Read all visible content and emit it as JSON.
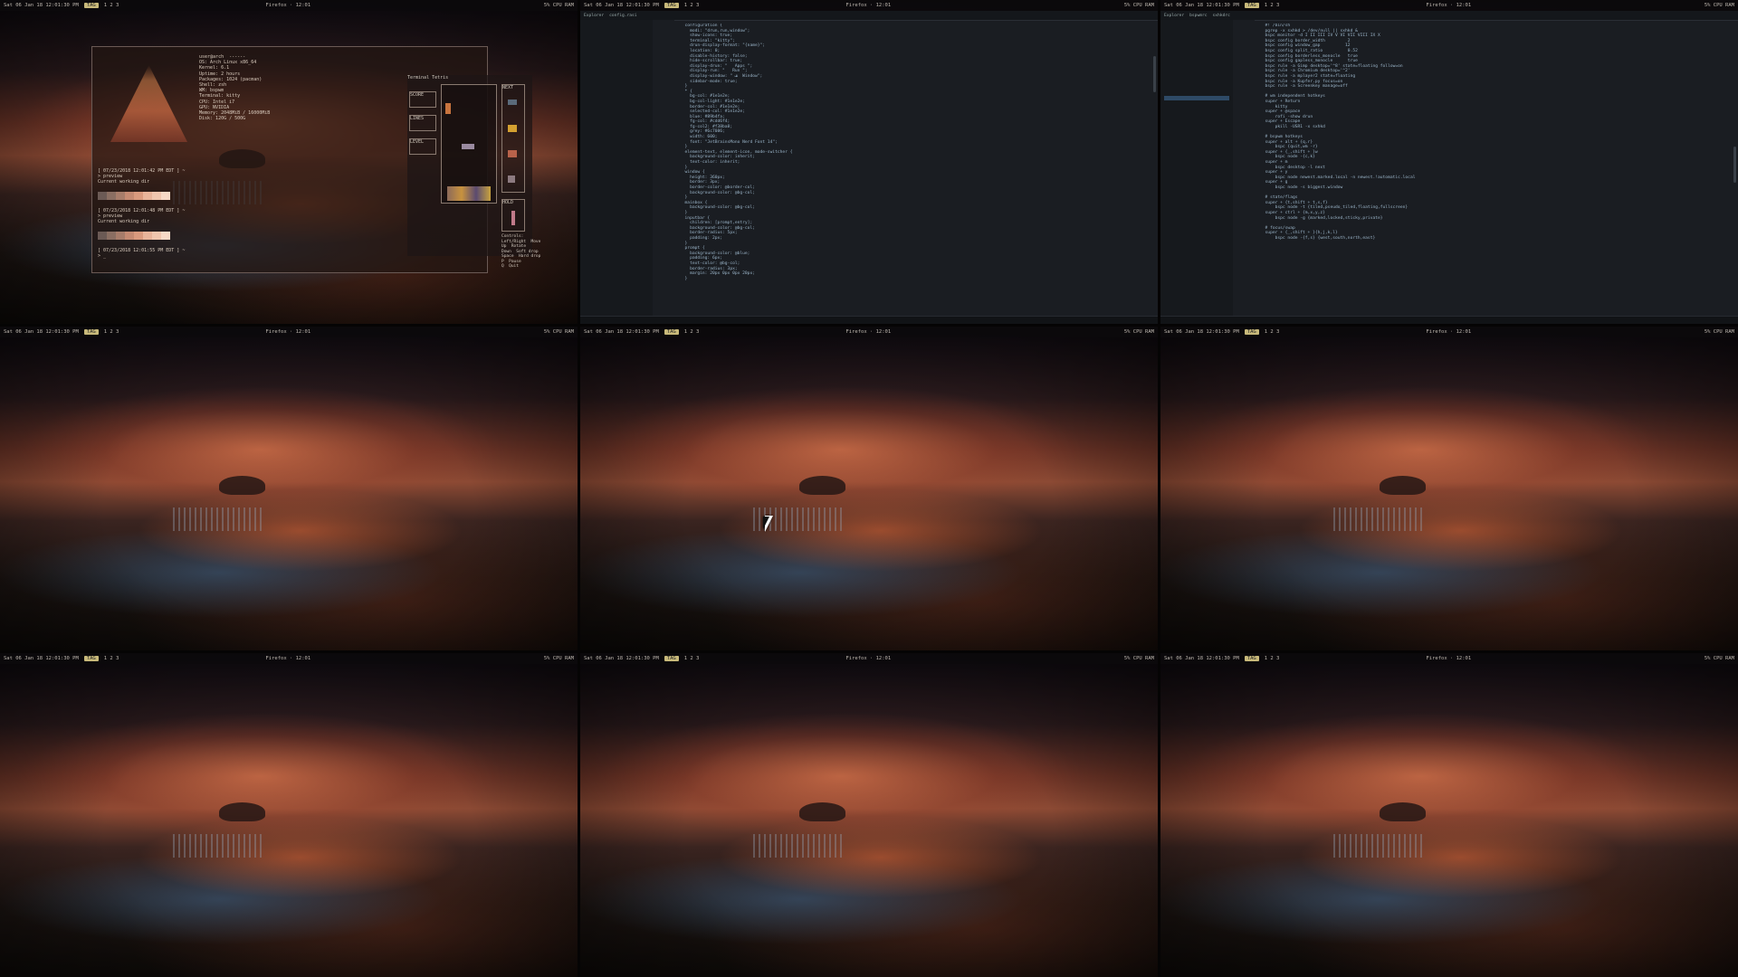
{
  "bar": {
    "left_text": "Sat 06 Jan 18  12:01:30 PM",
    "tag": "TAG",
    "tags_extra": "1 2 3",
    "center_text": "Firefox  ·  12:01",
    "right_text": "5%  CPU  RAM"
  },
  "workspaces": [
    {
      "id": 1,
      "name": "workspace-1",
      "content": "terminal"
    },
    {
      "id": 2,
      "name": "workspace-2",
      "content": "editor"
    },
    {
      "id": 3,
      "name": "workspace-3",
      "content": "editor"
    },
    {
      "id": 4,
      "name": "workspace-4",
      "content": "wallpaper"
    },
    {
      "id": 5,
      "name": "workspace-5",
      "content": "wallpaper"
    },
    {
      "id": 6,
      "name": "workspace-6",
      "content": "wallpaper"
    },
    {
      "id": 7,
      "name": "workspace-7",
      "content": "wallpaper"
    },
    {
      "id": 8,
      "name": "workspace-8",
      "content": "wallpaper"
    },
    {
      "id": 9,
      "name": "workspace-9",
      "content": "wallpaper"
    }
  ],
  "terminal": {
    "info_lines": "user@arch  ------\nOS: Arch Linux x86_64\nKernel: 6.1\nUptime: 2 hours\nPackages: 1024 (pacman)\nShell: zsh\nWM: bspwm\nTerminal: kitty\nCPU: Intel i7\nGPU: NVIDIA\nMemory: 2048MiB / 16000MiB\nDisk: 120G / 500G",
    "prompt1": "[ 07/23/2018 12:01:42 PM EDT ] ~\n> preview\nCurrent working dir",
    "prompt2": "[ 07/23/2018 12:01:48 PM EDT ] ~\n> preview\nCurrent working dir",
    "prompt3": "[ 07/23/2018 12:01:55 PM EDT ] ~\n> _",
    "swatch_colors": [
      "#6b5a55",
      "#8a6e62",
      "#a67c6a",
      "#c48a72",
      "#d99a7e",
      "#e8b49a",
      "#f0c6ae",
      "#f7d9c6"
    ]
  },
  "tetris": {
    "title": "Terminal Tetris",
    "score_label": "SCORE",
    "lines_label": "LINES",
    "level_label": "LEVEL",
    "next_label": "NEXT",
    "hold_label": "HOLD",
    "controls": "Controls:\nLeft/Right  Move\nUp  Rotate\nDown  Soft drop\nSpace  Hard drop\nP  Pause\nQ  Quit"
  },
  "editor_left": {
    "tabs": [
      "Explorer",
      "config.rasi"
    ],
    "code": "  configuration {\n    modi: \"drun,run,window\";\n    show-icons: true;\n    terminal: \"kitty\";\n    drun-display-format: \"{name}\";\n    location: 0;\n    disable-history: false;\n    hide-scrollbar: true;\n    display-drun: \"   Apps \";\n    display-run: \"   Run \";\n    display-window: \" ﭯ  Window\";\n    sidebar-mode: true;\n  }\n  * {\n    bg-col: #1e1e2e;\n    bg-col-light: #1e1e2e;\n    border-col: #1e1e2e;\n    selected-col: #1e1e2e;\n    blue: #89b4fa;\n    fg-col: #cdd6f4;\n    fg-col2: #f38ba8;\n    grey: #6c7086;\n    width: 600;\n    font: \"JetBrainsMono Nerd Font 14\";\n  }\n  element-text, element-icon, mode-switcher {\n    background-color: inherit;\n    text-color: inherit;\n  }\n  window {\n    height: 360px;\n    border: 3px;\n    border-color: @border-col;\n    background-color: @bg-col;\n  }\n  mainbox {\n    background-color: @bg-col;\n  }\n  inputbar {\n    children: [prompt,entry];\n    background-color: @bg-col;\n    border-radius: 5px;\n    padding: 2px;\n  }\n  prompt {\n    background-color: @blue;\n    padding: 6px;\n    text-color: @bg-col;\n    border-radius: 3px;\n    margin: 20px 0px 0px 20px;\n  }"
  },
  "editor_right": {
    "tabs": [
      "Explorer",
      "bspwmrc",
      "sxhkdrc"
    ],
    "code": "  #! /bin/sh\n  pgrep -x sxhkd > /dev/null || sxhkd &\n  bspc monitor -d I II III IV V VI VII VIII IX X\n  bspc config border_width         2\n  bspc config window_gap          12\n  bspc config split_ratio          0.52\n  bspc config borderless_monocle   true\n  bspc config gapless_monocle      true\n  bspc rule -a Gimp desktop='^8' state=floating follow=on\n  bspc rule -a Chromium desktop='^2'\n  bspc rule -a mplayer2 state=floating\n  bspc rule -a Kupfer.py focus=on\n  bspc rule -a Screenkey manage=off\n\n  # wm independent hotkeys\n  super + Return\n      kitty\n  super + @space\n      rofi -show drun\n  super + Escape\n      pkill -USR1 -x sxhkd\n\n  # bspwm hotkeys\n  super + alt + {q,r}\n      bspc {quit,wm -r}\n  super + {_,shift + }w\n      bspc node -{c,k}\n  super + m\n      bspc desktop -l next\n  super + y\n      bspc node newest.marked.local -n newest.!automatic.local\n  super + g\n      bspc node -s biggest.window\n\n  # state/flags\n  super + {t,shift + t,s,f}\n      bspc node -t {tiled,pseudo_tiled,floating,fullscreen}\n  super + ctrl + {m,x,y,z}\n      bspc node -g {marked,locked,sticky,private}\n\n  # focus/swap\n  super + {_,shift + }{h,j,k,l}\n      bspc node -{f,s} {west,south,north,east}"
  }
}
